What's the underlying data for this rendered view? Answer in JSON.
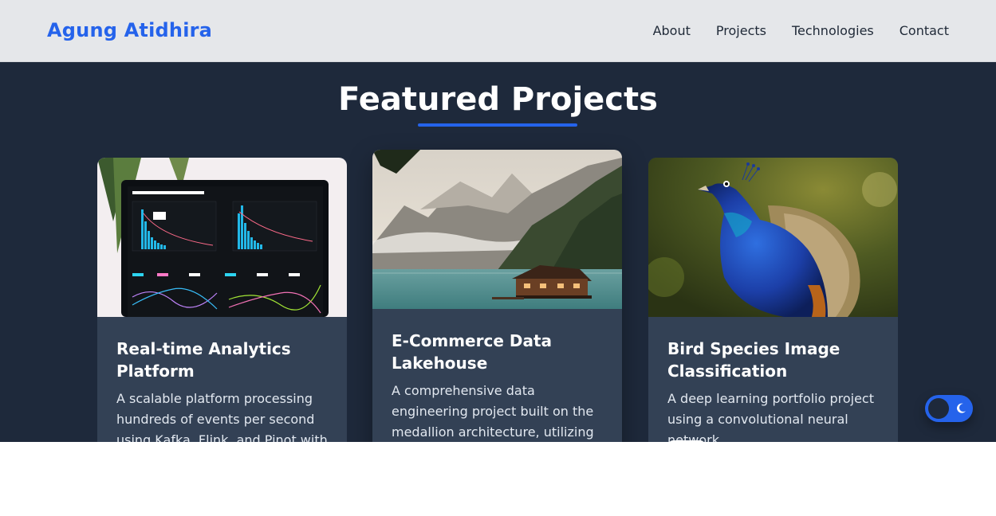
{
  "header": {
    "brand": "Agung Atidhira",
    "nav": [
      "About",
      "Projects",
      "Technologies",
      "Contact"
    ]
  },
  "section": {
    "title": "Featured Projects"
  },
  "projects": [
    {
      "title": "Real-time Analytics Platform",
      "description": "A scalable platform processing hundreds of events per second using Kafka, Flink, and Pinot with sub-",
      "image": "analytics-dashboard-on-laptop"
    },
    {
      "title": "E-Commerce Data Lakehouse",
      "description": "A comprehensive data engineering project built on the medallion architecture, utilizing Iceberg for a",
      "image": "mountain-lake-cabin"
    },
    {
      "title": "Bird Species Image Classification",
      "description": "A deep learning portfolio project using a convolutional neural network.",
      "image": "peacock-photo"
    }
  ],
  "theme_toggle": {
    "state": "dark",
    "icon": "moon-icon"
  },
  "colors": {
    "accent": "#2563eb",
    "section_bg": "#1e293b",
    "card_bg": "#334155",
    "header_bg": "#e5e7ea"
  }
}
